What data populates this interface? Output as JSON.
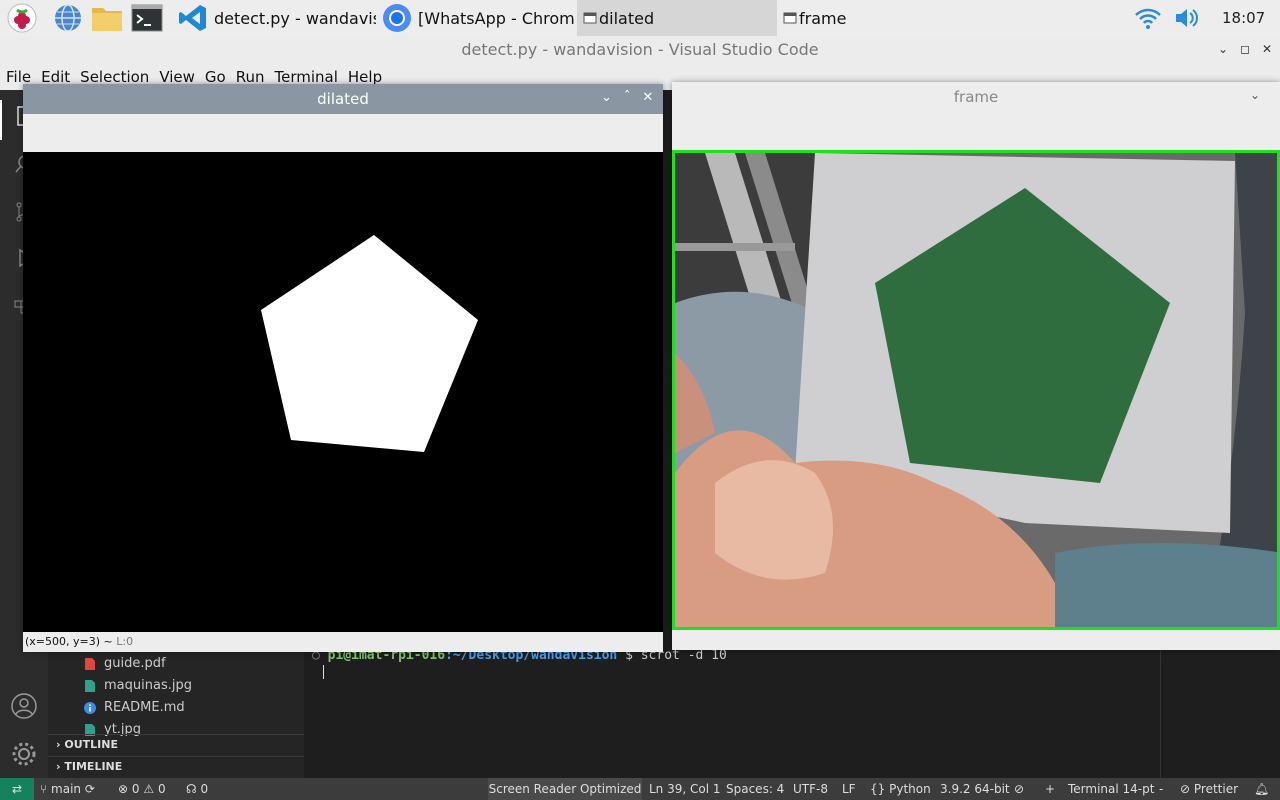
{
  "taskbar": {
    "launchers": [
      "raspberry-menu-icon",
      "browser-globe-icon",
      "file-manager-icon",
      "terminal-icon"
    ],
    "windows": [
      {
        "title": "detect.py - wandavisi...",
        "icon": "vscode-icon"
      },
      {
        "title": "[WhatsApp - Chromiu...",
        "icon": "chromium-icon"
      },
      {
        "title": "dilated",
        "icon": "window-icon"
      },
      {
        "title": "frame",
        "icon": "window-icon"
      }
    ],
    "clock": "18:07"
  },
  "vscode": {
    "title": "detect.py - wandavision - Visual Studio Code",
    "menu": [
      "File",
      "Edit",
      "Selection",
      "View",
      "Go",
      "Run",
      "Terminal",
      "Help"
    ],
    "explorer": {
      "files": [
        {
          "name": "guide.pdf",
          "icon": "pdf-icon"
        },
        {
          "name": "maquinas.jpg",
          "icon": "image-icon"
        },
        {
          "name": "README.md",
          "icon": "info-icon"
        },
        {
          "name": "yt.jpg",
          "icon": "image-icon"
        }
      ],
      "sections": [
        "OUTLINE",
        "TIMELINE"
      ]
    },
    "terminal": {
      "user": "pi@imat-rpi-016",
      "path": ":~/Desktop/wandavision",
      "prompt": "$",
      "command": "scrot -d 10"
    },
    "statusbar": {
      "branch": "main",
      "errors": "0",
      "warnings": "0",
      "ports": "0",
      "reader": "Screen Reader Optimized",
      "position": "Ln 39, Col 1",
      "spaces": "Spaces: 4",
      "encoding": "UTF-8",
      "eol": "LF",
      "language": "Python",
      "interpreter": "3.9.2 64-bit",
      "plus": "+",
      "terminal": "Terminal 14-pt",
      "dash": "-",
      "prettier": "Prettier"
    }
  },
  "dilated_window": {
    "title": "dilated",
    "status": "(x=500, y=3) ~",
    "status_suffix": "L:0"
  },
  "frame_window": {
    "title": "frame"
  },
  "colors": {
    "vscode_accent": "#16825d",
    "frame_border": "#1fe01f",
    "pentagon_green": "#2f6d3e"
  }
}
